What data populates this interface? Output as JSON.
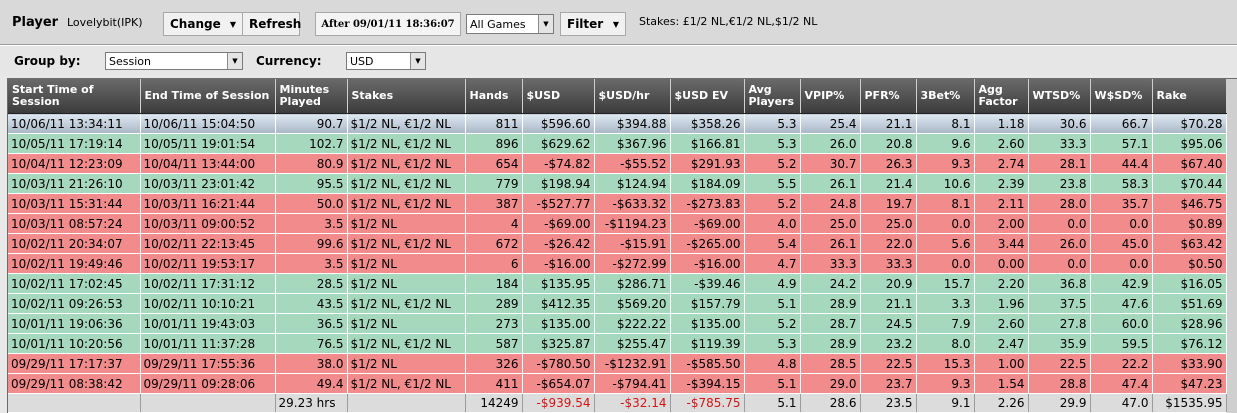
{
  "toolbar": {
    "player_label": "Player",
    "player_name": "Lovelybit(IPK)",
    "change_label": "Change",
    "refresh_label": "Refresh",
    "date_filter": "After 09/01/11 18:36:07",
    "games_value": "All Games",
    "filter_label": "Filter",
    "stakes_info": "Stakes: £1/2 NL,€1/2 NL,$1/2 NL"
  },
  "groupbar": {
    "group_label": "Group by:",
    "group_value": "Session",
    "currency_label": "Currency:",
    "currency_value": "USD"
  },
  "colors": {
    "win_row": "#a6d8bd",
    "loss_row": "#f28b8b",
    "header": "#4a4a4a",
    "negative_total": "#d21414"
  },
  "columns": [
    "Start Time of Session",
    "End Time of Session",
    "Minutes Played",
    "Stakes",
    "Hands",
    "$USD",
    "$USD/hr",
    "$USD EV",
    "Avg Players",
    "VPIP%",
    "PFR%",
    "3Bet%",
    "Agg Factor",
    "WTSD%",
    "W$SD%",
    "Rake"
  ],
  "rows": [
    {
      "status": "sel",
      "cells": [
        "10/06/11 13:34:11",
        "10/06/11 15:04:50",
        "90.7",
        "$1/2 NL, €1/2 NL",
        "811",
        "$596.60",
        "$394.88",
        "$358.26",
        "5.3",
        "25.4",
        "21.1",
        "8.1",
        "1.18",
        "30.6",
        "66.7",
        "$70.28"
      ]
    },
    {
      "status": "win",
      "cells": [
        "10/05/11 17:19:14",
        "10/05/11 19:01:54",
        "102.7",
        "$1/2 NL, €1/2 NL",
        "896",
        "$629.62",
        "$367.96",
        "$166.81",
        "5.3",
        "26.0",
        "20.8",
        "9.6",
        "2.60",
        "33.3",
        "57.1",
        "$95.06"
      ]
    },
    {
      "status": "loss",
      "cells": [
        "10/04/11 12:23:09",
        "10/04/11 13:44:00",
        "80.9",
        "$1/2 NL, €1/2 NL",
        "654",
        "-$74.82",
        "-$55.52",
        "$291.93",
        "5.2",
        "30.7",
        "26.3",
        "9.3",
        "2.74",
        "28.1",
        "44.4",
        "$67.40"
      ]
    },
    {
      "status": "win",
      "cells": [
        "10/03/11 21:26:10",
        "10/03/11 23:01:42",
        "95.5",
        "$1/2 NL, €1/2 NL",
        "779",
        "$198.94",
        "$124.94",
        "$184.09",
        "5.5",
        "26.1",
        "21.4",
        "10.6",
        "2.39",
        "23.8",
        "58.3",
        "$70.44"
      ]
    },
    {
      "status": "loss",
      "cells": [
        "10/03/11 15:31:44",
        "10/03/11 16:21:44",
        "50.0",
        "$1/2 NL, €1/2 NL",
        "387",
        "-$527.77",
        "-$633.32",
        "-$273.83",
        "5.2",
        "24.8",
        "19.7",
        "8.1",
        "2.11",
        "28.0",
        "35.7",
        "$46.75"
      ]
    },
    {
      "status": "loss",
      "cells": [
        "10/03/11 08:57:24",
        "10/03/11 09:00:52",
        "3.5",
        "$1/2 NL",
        "4",
        "-$69.00",
        "-$1194.23",
        "-$69.00",
        "4.0",
        "25.0",
        "25.0",
        "0.0",
        "2.00",
        "0.0",
        "0.0",
        "$0.89"
      ]
    },
    {
      "status": "loss",
      "cells": [
        "10/02/11 20:34:07",
        "10/02/11 22:13:45",
        "99.6",
        "$1/2 NL, €1/2 NL",
        "672",
        "-$26.42",
        "-$15.91",
        "-$265.00",
        "5.4",
        "26.1",
        "22.0",
        "5.6",
        "3.44",
        "26.0",
        "45.0",
        "$63.42"
      ]
    },
    {
      "status": "loss",
      "cells": [
        "10/02/11 19:49:46",
        "10/02/11 19:53:17",
        "3.5",
        "$1/2 NL",
        "6",
        "-$16.00",
        "-$272.99",
        "-$16.00",
        "4.7",
        "33.3",
        "33.3",
        "0.0",
        "0.00",
        "0.0",
        "0.0",
        "$0.50"
      ]
    },
    {
      "status": "win",
      "cells": [
        "10/02/11 17:02:45",
        "10/02/11 17:31:12",
        "28.5",
        "$1/2 NL",
        "184",
        "$135.95",
        "$286.71",
        "-$39.46",
        "4.9",
        "24.2",
        "20.9",
        "15.7",
        "2.20",
        "36.8",
        "42.9",
        "$16.05"
      ]
    },
    {
      "status": "win",
      "cells": [
        "10/02/11 09:26:53",
        "10/02/11 10:10:21",
        "43.5",
        "$1/2 NL, €1/2 NL",
        "289",
        "$412.35",
        "$569.20",
        "$157.79",
        "5.1",
        "28.9",
        "21.1",
        "3.3",
        "1.96",
        "37.5",
        "47.6",
        "$51.69"
      ]
    },
    {
      "status": "win",
      "cells": [
        "10/01/11 19:06:36",
        "10/01/11 19:43:03",
        "36.5",
        "$1/2 NL",
        "273",
        "$135.00",
        "$222.22",
        "$135.00",
        "5.2",
        "28.7",
        "24.5",
        "7.9",
        "2.60",
        "27.8",
        "60.0",
        "$28.96"
      ]
    },
    {
      "status": "win",
      "cells": [
        "10/01/11 10:20:56",
        "10/01/11 11:37:28",
        "76.5",
        "$1/2 NL, €1/2 NL",
        "587",
        "$325.87",
        "$255.47",
        "$119.39",
        "5.3",
        "28.9",
        "23.2",
        "8.0",
        "2.47",
        "35.9",
        "59.5",
        "$76.12"
      ]
    },
    {
      "status": "loss",
      "cells": [
        "09/29/11 17:17:37",
        "09/29/11 17:55:36",
        "38.0",
        "$1/2 NL",
        "326",
        "-$780.50",
        "-$1232.91",
        "-$585.50",
        "4.8",
        "28.5",
        "22.5",
        "15.3",
        "1.00",
        "22.5",
        "22.2",
        "$33.90"
      ]
    },
    {
      "status": "loss",
      "cells": [
        "09/29/11 08:38:42",
        "09/29/11 09:28:06",
        "49.4",
        "$1/2 NL, €1/2 NL",
        "411",
        "-$654.07",
        "-$794.41",
        "-$394.15",
        "5.1",
        "29.0",
        "23.7",
        "9.3",
        "1.54",
        "28.8",
        "47.4",
        "$47.23"
      ]
    }
  ],
  "totals": [
    "",
    "",
    "29.23 hrs",
    "",
    "14249",
    "-$939.54",
    "-$32.14",
    "-$785.75",
    "5.1",
    "28.6",
    "23.5",
    "9.1",
    "2.26",
    "29.9",
    "47.0",
    "$1535.95"
  ]
}
